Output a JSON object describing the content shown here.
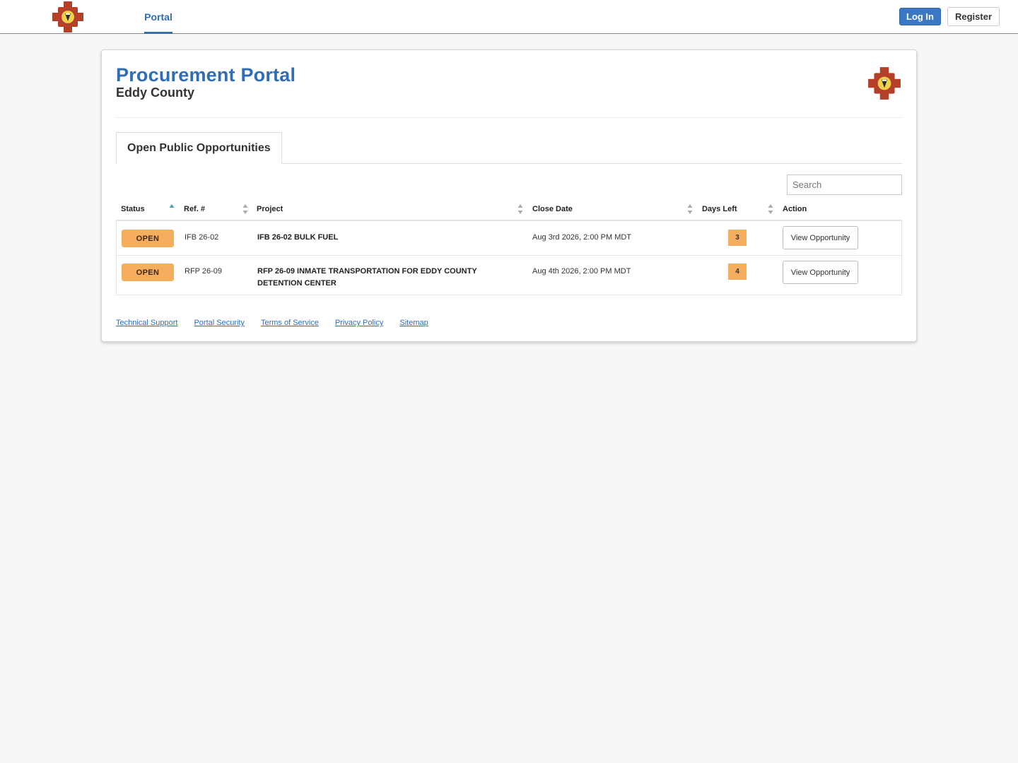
{
  "nav": {
    "logo_icon": "county-seal-logo",
    "tabs": [
      {
        "label": "Portal",
        "active": true
      }
    ],
    "login_label": "Log In",
    "register_label": "Register"
  },
  "header": {
    "title": "Procurement Portal",
    "subtitle": "Eddy County",
    "logo_icon": "county-seal-logo"
  },
  "tabs": [
    {
      "label": "Open Public Opportunities",
      "active": true
    }
  ],
  "search": {
    "placeholder": "Search",
    "value": ""
  },
  "table": {
    "columns": [
      "Status",
      "Ref. #",
      "Project",
      "Close Date",
      "Days Left",
      "Action"
    ],
    "sorted_column": "Status",
    "rows": [
      {
        "status": "OPEN",
        "ref": "IFB 26-02",
        "project": "IFB 26-02 BULK FUEL",
        "close_date": "Aug 3rd 2026, 2:00 PM MDT",
        "days_left": "3",
        "action": "View Opportunity"
      },
      {
        "status": "OPEN",
        "ref": "RFP 26-09",
        "project": "RFP 26-09 INMATE TRANSPORTATION FOR EDDY COUNTY DETENTION CENTER",
        "close_date": "Aug 4th 2026, 2:00 PM MDT",
        "days_left": "4",
        "action": "View Opportunity"
      }
    ]
  },
  "footer": {
    "links": [
      "Technical Support",
      "Portal Security",
      "Terms of Service",
      "Privacy Policy",
      "Sitemap"
    ]
  },
  "colors": {
    "brand_blue": "#2f6db5",
    "login_button": "#3a78c4",
    "status_open": "#f6ad5d",
    "days_badge": "#f6ad5d",
    "page_background": "#f7f7f7"
  }
}
